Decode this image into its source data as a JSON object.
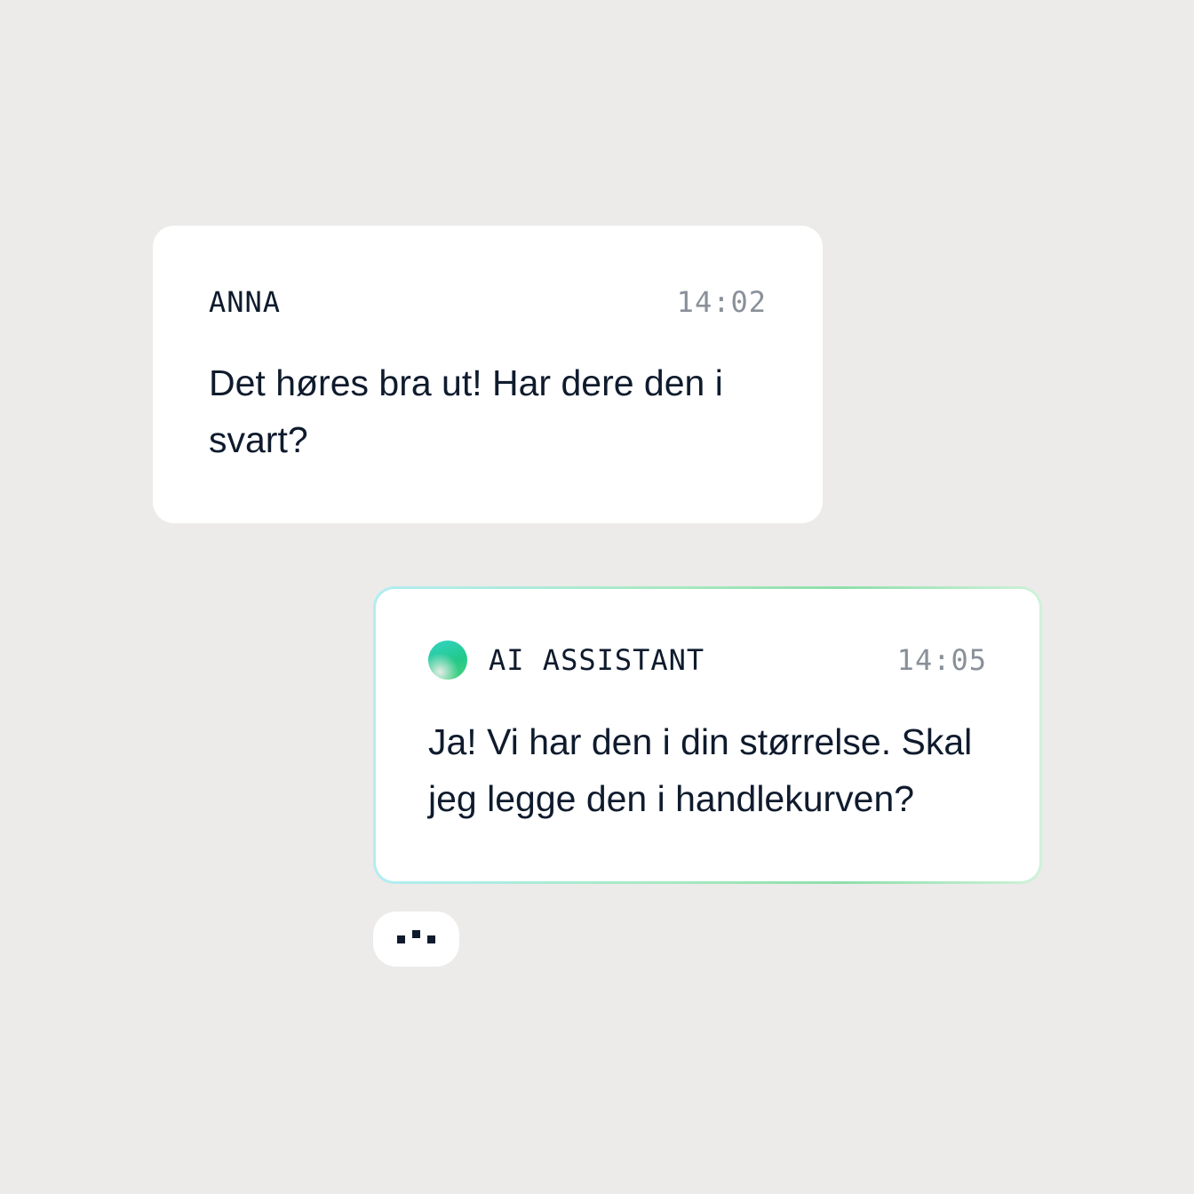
{
  "messages": [
    {
      "sender": "ANNA",
      "time": "14:02",
      "text": "Det høres bra ut! Har dere den i svart?"
    },
    {
      "sender": "AI ASSISTANT",
      "time": "14:05",
      "text": "Ja! Vi har den i din størrelse. Skal jeg legge den i handlekurven?",
      "avatar_icon": "ai-avatar-orb"
    }
  ],
  "typing_indicator": {
    "icon": "typing-dots",
    "dots": 3
  },
  "colors": {
    "background": "#ECEBE9",
    "bubble": "#FFFFFF",
    "text": "#0F1B2D",
    "timestamp": "#8A9099",
    "accent_green": "#22C98A",
    "accent_cyan": "#34D4C8"
  }
}
